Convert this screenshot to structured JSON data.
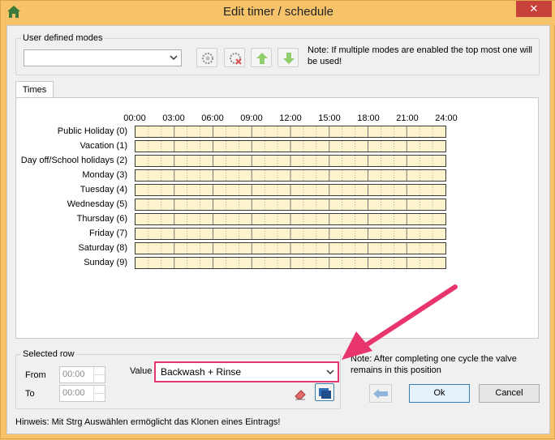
{
  "window": {
    "title": "Edit timer / schedule",
    "close_glyph": "✕"
  },
  "modes": {
    "group_label": "User defined modes",
    "combo_value": "",
    "note": "Note: If multiple modes are enabled the top most one will be used!",
    "icons": [
      "add-mode-icon",
      "remove-mode-icon",
      "move-up-icon",
      "move-down-icon"
    ]
  },
  "tabs": {
    "times_label": "Times"
  },
  "schedule": {
    "time_labels": [
      "00:00",
      "03:00",
      "06:00",
      "09:00",
      "12:00",
      "15:00",
      "18:00",
      "21:00",
      "24:00"
    ],
    "days": [
      "Public Holiday (0)",
      "Vacation (1)",
      "Day off/School holidays (2)",
      "Monday (3)",
      "Tuesday (4)",
      "Wednesday (5)",
      "Thursday (6)",
      "Friday (7)",
      "Saturday (8)",
      "Sunday (9)"
    ],
    "bar_fill": "#fdf3cc"
  },
  "selected_row": {
    "group_label": "Selected row",
    "from_label": "From",
    "to_label": "To",
    "from_value": "00:00",
    "to_value": "00:00",
    "value_label": "Value",
    "value_selected": "Backwash + Rinse"
  },
  "bottom": {
    "note": "Note: After completing one cycle the valve remains in this position",
    "ok_label": "Ok",
    "cancel_label": "Cancel",
    "hint": "Hinweis: Mit Strg Auswählen ermöglicht das Klonen eines Eintrags!"
  },
  "colors": {
    "title_bar": "#f6c36a",
    "close": "#c7403a",
    "highlight": "#e8356d",
    "accent": "#3c7fb1"
  }
}
